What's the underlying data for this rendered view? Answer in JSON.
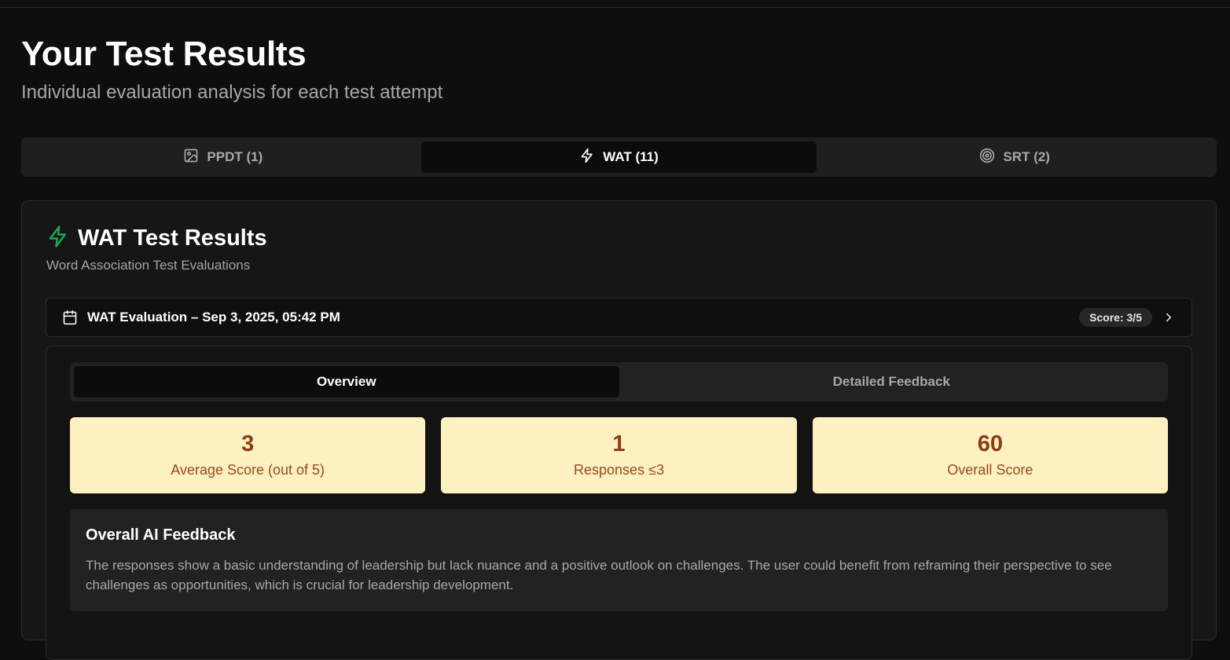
{
  "header": {
    "title": "Your Test Results",
    "subtitle": "Individual evaluation analysis for each test attempt"
  },
  "tabs": [
    {
      "label": "PPDT (1)",
      "icon": "image-icon",
      "active": false
    },
    {
      "label": "WAT (11)",
      "icon": "lightning-icon",
      "active": true
    },
    {
      "label": "SRT (2)",
      "icon": "target-icon",
      "active": false
    }
  ],
  "card": {
    "title": "WAT Test Results",
    "subtitle": "Word Association Test Evaluations",
    "icon": "lightning-icon",
    "icon_color": "#22a352"
  },
  "evaluation": {
    "title": "WAT Evaluation – Sep 3, 2025, 05:42 PM",
    "score_badge": "Score: 3/5",
    "icon": "calendar-icon",
    "expand_icon": "chevron-right-icon"
  },
  "subtabs": [
    {
      "label": "Overview",
      "active": true
    },
    {
      "label": "Detailed Feedback",
      "active": false
    }
  ],
  "stats": [
    {
      "value": "3",
      "label": "Average Score (out of 5)"
    },
    {
      "value": "1",
      "label": "Responses ≤3"
    },
    {
      "value": "60",
      "label": "Overall Score"
    }
  ],
  "feedback": {
    "title": "Overall AI Feedback",
    "text": "The responses show a basic understanding of leadership but lack nuance and a positive outlook on challenges. The user could benefit from reframing their perspective to see challenges as opportunities, which is crucial for leadership development."
  },
  "colors": {
    "background": "#0e0e0e",
    "stat_card_bg": "#fef1c1",
    "stat_value": "#8a3c12",
    "accent_green": "#22a352"
  }
}
